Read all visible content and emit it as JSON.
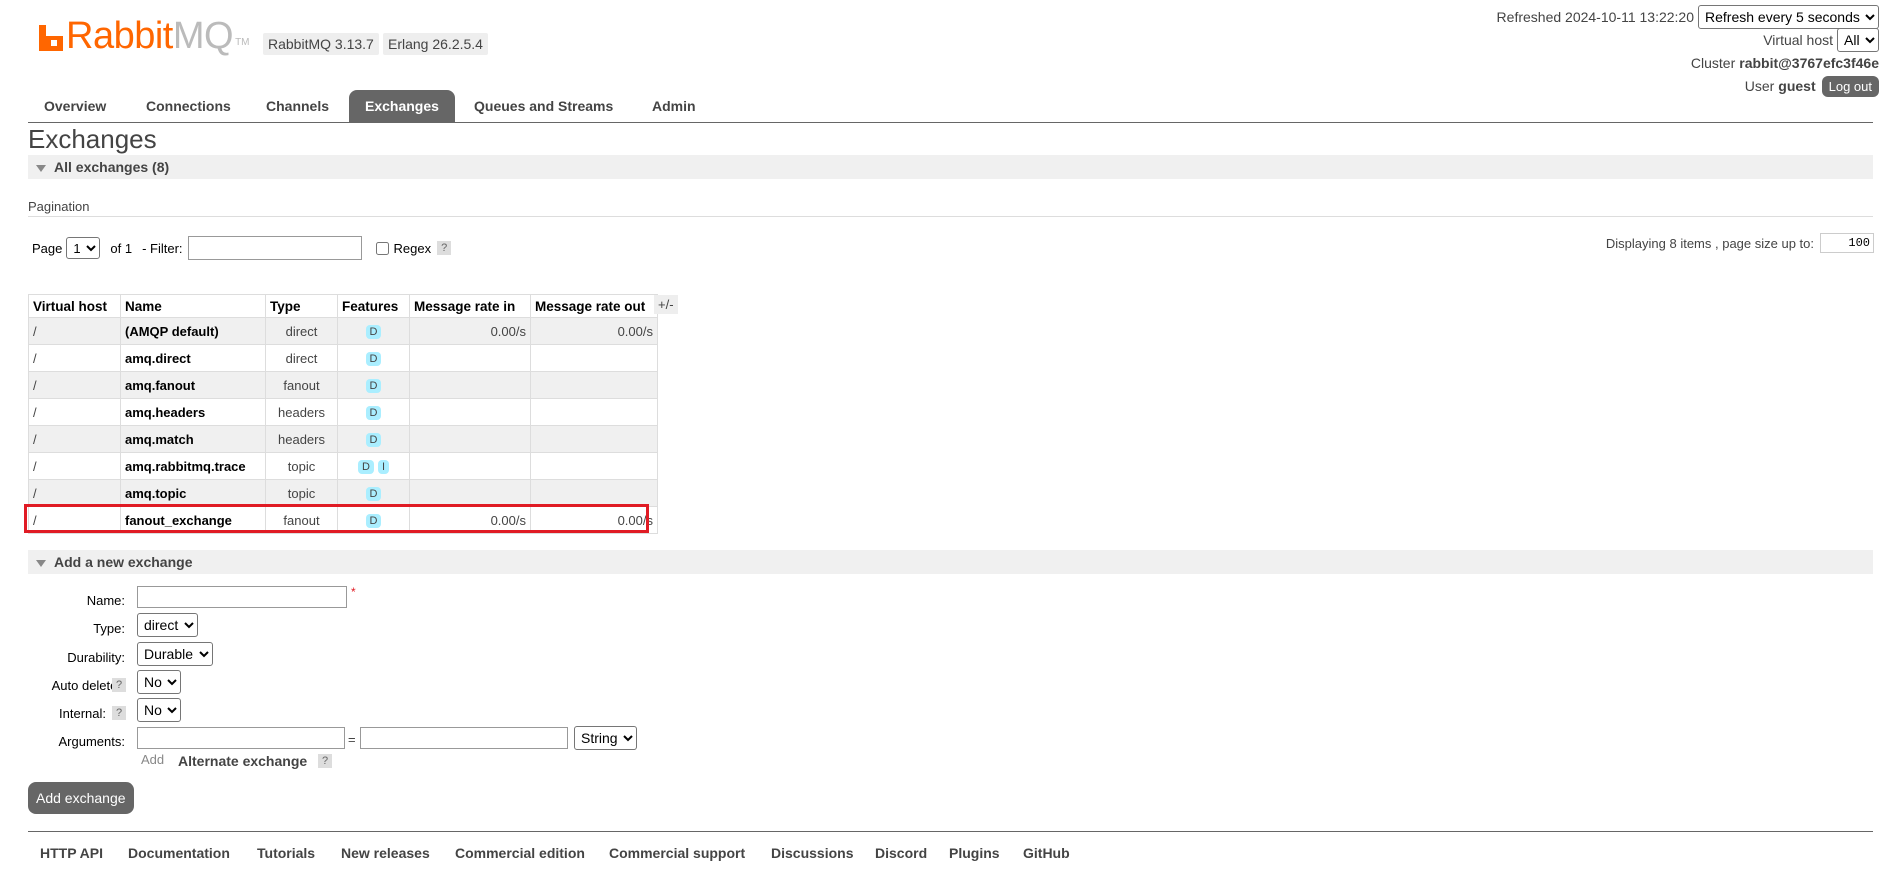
{
  "header": {
    "logo_text_main": "Rabbit",
    "logo_text_mq": "MQ",
    "logo_tm": "TM",
    "version_rabbit": "RabbitMQ 3.13.7",
    "version_erlang": "Erlang 26.2.5.4",
    "refreshed_label": "Refreshed 2024-10-11 13:22:20",
    "refresh_select": "Refresh every 5 seconds",
    "vhost_label": "Virtual host",
    "vhost_select": "All",
    "cluster_label": "Cluster",
    "cluster_name": "rabbit@3767efc3f46e",
    "user_label": "User",
    "user_name": "guest",
    "logout_label": "Log out"
  },
  "tabs": [
    {
      "label": "Overview"
    },
    {
      "label": "Connections"
    },
    {
      "label": "Channels"
    },
    {
      "label": "Exchanges",
      "active": true
    },
    {
      "label": "Queues and Streams"
    },
    {
      "label": "Admin"
    }
  ],
  "page_title": "Exchanges",
  "all_exchanges": {
    "heading": "All exchanges (8)",
    "pagination_label": "Pagination",
    "page_label": "Page",
    "page_value": "1",
    "of_label": "of 1",
    "filter_label": "- Filter:",
    "regex_label": "Regex",
    "help_glyph": "?",
    "displaying_label": "Displaying 8 items , page size up to:",
    "page_size": "100",
    "toggle_columns": "+/-",
    "columns": [
      "Virtual host",
      "Name",
      "Type",
      "Features",
      "Message rate in",
      "Message rate out"
    ],
    "rows": [
      {
        "vhost": "/",
        "name": "(AMQP default)",
        "type": "direct",
        "features": [
          "D"
        ],
        "rate_in": "0.00/s",
        "rate_out": "0.00/s"
      },
      {
        "vhost": "/",
        "name": "amq.direct",
        "type": "direct",
        "features": [
          "D"
        ],
        "rate_in": "",
        "rate_out": ""
      },
      {
        "vhost": "/",
        "name": "amq.fanout",
        "type": "fanout",
        "features": [
          "D"
        ],
        "rate_in": "",
        "rate_out": ""
      },
      {
        "vhost": "/",
        "name": "amq.headers",
        "type": "headers",
        "features": [
          "D"
        ],
        "rate_in": "",
        "rate_out": ""
      },
      {
        "vhost": "/",
        "name": "amq.match",
        "type": "headers",
        "features": [
          "D"
        ],
        "rate_in": "",
        "rate_out": ""
      },
      {
        "vhost": "/",
        "name": "amq.rabbitmq.trace",
        "type": "topic",
        "features": [
          "D",
          "I"
        ],
        "rate_in": "",
        "rate_out": ""
      },
      {
        "vhost": "/",
        "name": "amq.topic",
        "type": "topic",
        "features": [
          "D"
        ],
        "rate_in": "",
        "rate_out": ""
      },
      {
        "vhost": "/",
        "name": "fanout_exchange",
        "type": "fanout",
        "features": [
          "D"
        ],
        "rate_in": "0.00/s",
        "rate_out": "0.00/s"
      }
    ]
  },
  "add_exchange": {
    "heading": "Add a new exchange",
    "name_label": "Name:",
    "required_mark": "*",
    "type_label": "Type:",
    "type_value": "direct",
    "durability_label": "Durability:",
    "durability_value": "Durable",
    "auto_delete_label": "Auto delete:",
    "auto_delete_value": "No",
    "internal_label": "Internal:",
    "internal_value": "No",
    "arguments_label": "Arguments:",
    "eq": "=",
    "arg_type_value": "String",
    "add_label": "Add",
    "alternate_exchange_label": "Alternate exchange",
    "submit_label": "Add exchange"
  },
  "footer": {
    "links": [
      "HTTP API",
      "Documentation",
      "Tutorials",
      "New releases",
      "Commercial edition",
      "Commercial support",
      "Discussions",
      "Discord",
      "Plugins",
      "GitHub"
    ]
  },
  "colors": {
    "brand_orange": "#ff6600",
    "highlight_red": "#e01b24",
    "tab_active": "#666666",
    "feature_badge": "#aaeeff"
  }
}
